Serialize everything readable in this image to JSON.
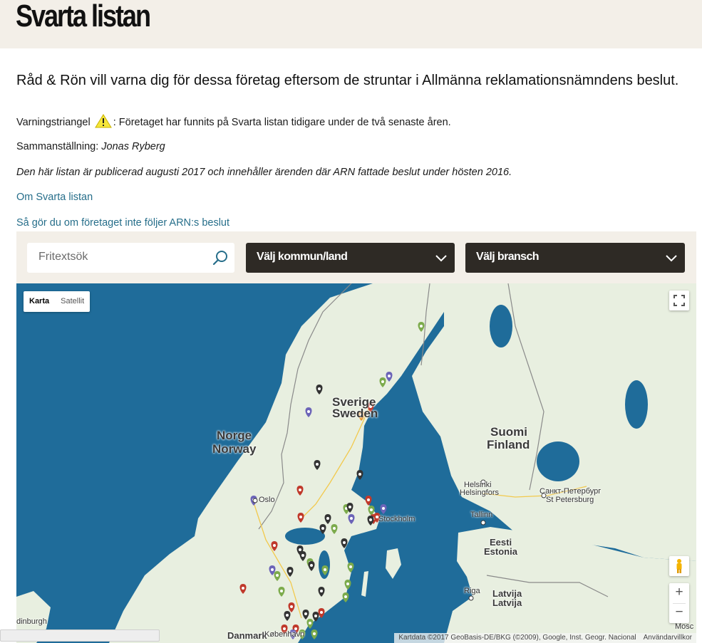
{
  "page": {
    "title": "Svarta listan",
    "lead": "Råd & Rön vill varna dig för dessa företag eftersom de struntar i Allmänna reklamationsnämndens beslut.",
    "warning_prefix": "Varningstriangel",
    "warning_text": ": Företaget har funnits på Svarta listan tidigare under de två senaste åren.",
    "compiled_label": "Sammanställning:",
    "compiled_name": "Jonas Ryberg",
    "published_note": "Den här listan är publicerad augusti 2017 och innehåller ärenden där ARN fattade beslut under hösten 2016.",
    "link_about": "Om Svarta listan",
    "link_howto": "Så gör du om företaget inte följer ARN:s beslut"
  },
  "filters": {
    "search_placeholder": "Fritextsök",
    "municipality_label": "Välj kommun/land",
    "industry_label": "Välj bransch"
  },
  "map": {
    "type_map": "Karta",
    "type_satellite": "Satellit",
    "zoom_in": "+",
    "zoom_out": "−",
    "attribution": "Kartdata ©2017 GeoBasis-DE/BKG (©2009), Google, Inst. Geogr. Nacional",
    "terms": "Användarvillkor",
    "labels": {
      "sverige": "Sverige",
      "sweden": "Sweden",
      "norge": "Norge",
      "norway": "Norway",
      "suomi": "Suomi",
      "finland": "Finland",
      "eesti": "Eesti",
      "estonia": "Estonia",
      "latvija1": "Latvija",
      "latvija2": "Latvija",
      "danmark": "Danmark",
      "helsinki": "Helsinki",
      "helsingfors": "Helsingfors",
      "spb_ru": "Санкт-Петербург",
      "spb": "St Petersburg",
      "tallinn": "Tallinn",
      "riga": "Riga",
      "stockholm": "Stockholm",
      "oslo": "Oslo",
      "edinburgh": "dinburgh",
      "kobenhavn": "København",
      "moscow": "Mosc"
    },
    "colors": {
      "water": "#1f6c9a",
      "land": "#e8efe0",
      "marker_black": "#333333",
      "marker_red": "#c0392b",
      "marker_green": "#7cab4c",
      "marker_purple": "#6c64b8",
      "marker_orange": "#e8962f"
    }
  }
}
